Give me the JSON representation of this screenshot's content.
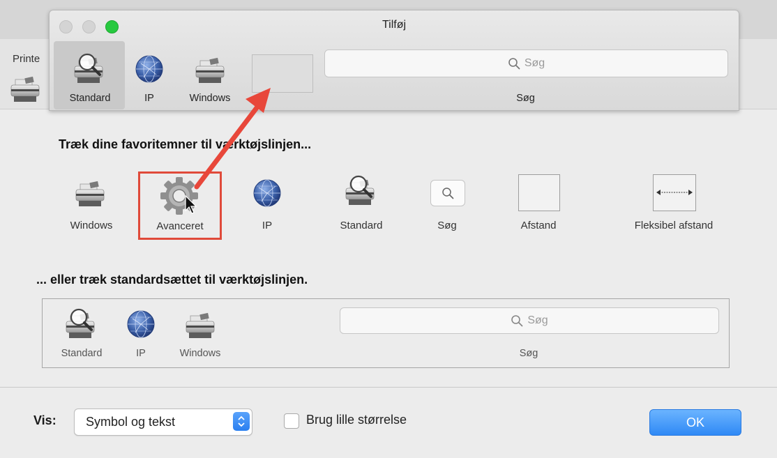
{
  "background_window": {
    "tab_label_partial": "Printe"
  },
  "sheet": {
    "title": "Tilføj",
    "toolbar": [
      {
        "label": "Standard",
        "icon": "printer-magnifier-icon",
        "selected": true
      },
      {
        "label": "IP",
        "icon": "globe-icon"
      },
      {
        "label": "Windows",
        "icon": "printer-icon"
      }
    ],
    "search": {
      "placeholder": "Søg",
      "label": "Søg"
    }
  },
  "palette": {
    "heading": "Træk dine favoritemner til værktøjslinjen...",
    "items": [
      {
        "label": "Windows",
        "icon": "printer-icon"
      },
      {
        "label": "Avanceret",
        "icon": "gear-icon",
        "highlighted": true
      },
      {
        "label": "IP",
        "icon": "globe-icon"
      },
      {
        "label": "Standard",
        "icon": "printer-magnifier-icon"
      },
      {
        "label": "Søg",
        "icon": "search-icon"
      },
      {
        "label": "Afstand",
        "icon": "space-icon"
      },
      {
        "label": "Fleksibel afstand",
        "icon": "flexible-space-icon"
      }
    ]
  },
  "default_set": {
    "heading": "... eller træk standardsættet til værktøjslinjen.",
    "items": [
      {
        "label": "Standard",
        "icon": "printer-magnifier-icon"
      },
      {
        "label": "IP",
        "icon": "globe-icon"
      },
      {
        "label": "Windows",
        "icon": "printer-icon"
      }
    ],
    "search": {
      "placeholder": "Søg",
      "label": "Søg"
    }
  },
  "footer": {
    "show_label": "Vis:",
    "show_value": "Symbol og tekst",
    "small_size_label": "Brug lille størrelse",
    "small_size_checked": false,
    "ok_label": "OK"
  },
  "colors": {
    "accent": "#2f89f5",
    "highlight_box": "#e04a3a",
    "arrow": "#e8473a",
    "zoom_green": "#27c93f"
  }
}
